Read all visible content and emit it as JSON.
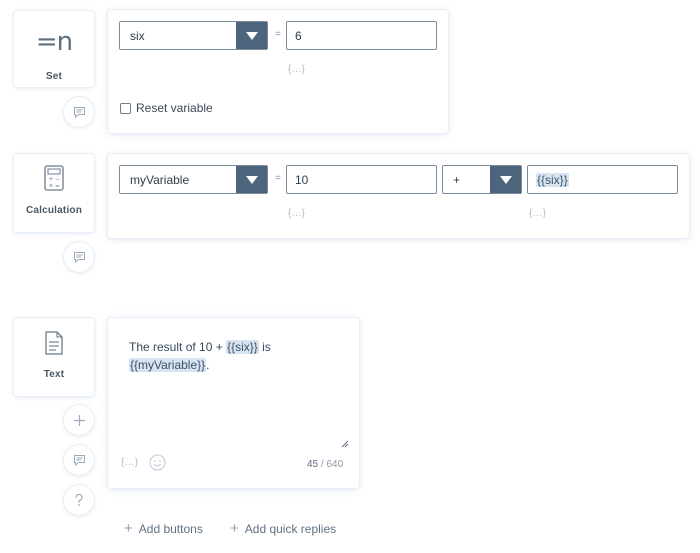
{
  "set_block": {
    "label": "Set",
    "icon": "=n",
    "variable_select": "six",
    "equals": "=",
    "value": "6",
    "braces": "{...}",
    "reset_label": "Reset variable"
  },
  "calc_block": {
    "label": "Calculation",
    "variable_select": "myVariable",
    "equals": "=",
    "operand1": "10",
    "operand1_braces": "{...}",
    "operator_select": "+",
    "operand2": "{{six}}",
    "operand2_braces": "{...}"
  },
  "text_block": {
    "label": "Text",
    "text_part1": "The result of 10 + ",
    "text_tag1": "{{six}}",
    "text_part2": " is",
    "text_tag2": "{{myVariable}}",
    "text_part3": ".",
    "braces": "{...}",
    "count_current": "45",
    "count_max": " / 640"
  },
  "actions": {
    "add_buttons": "Add buttons",
    "add_quick_replies": "Add quick replies"
  },
  "icons": {
    "comment": "comment-icon",
    "plus": "plus-icon",
    "help": "question-icon",
    "calculator": "calculator-icon",
    "document": "document-icon",
    "emoji": "smiley-icon",
    "dropdown": "caret-down-icon"
  },
  "colors": {
    "accent": "#4d657c",
    "tag_bg": "#d7e3ee",
    "card_shadow": "#e6eef6"
  }
}
